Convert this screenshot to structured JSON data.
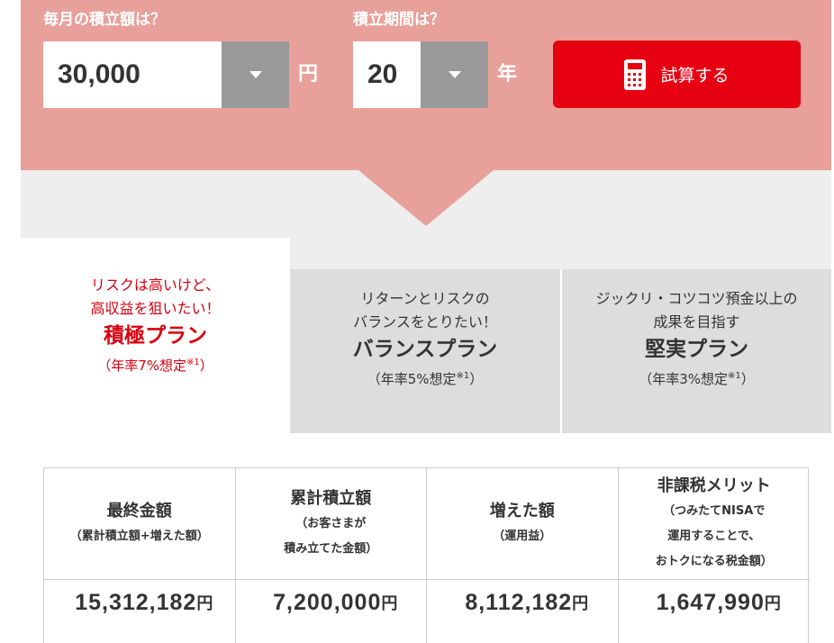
{
  "form": {
    "monthly_label": "毎月の積立額は？",
    "monthly_value": "30,000",
    "monthly_unit": "円",
    "period_label": "積立期間は？",
    "period_value": "20",
    "period_unit": "年",
    "calc_button": "試算する"
  },
  "plans": [
    {
      "desc1": "リスクは高いけど、",
      "desc2": "高収益を狙いたい！",
      "name": "積極プラン",
      "note": "（年率7%想定",
      "mark": "※1",
      "close": "）",
      "selected": true
    },
    {
      "desc1": "リターンとリスクの",
      "desc2": "バランスをとりたい！",
      "name": "バランスプラン",
      "note": "（年率5%想定",
      "mark": "※1",
      "close": "）",
      "selected": false
    },
    {
      "desc1": "ジックリ・コツコツ預金以上の",
      "desc2": "成果を目指す",
      "name": "堅実プラン",
      "note": "（年率3%想定",
      "mark": "※1",
      "close": "）",
      "selected": false
    }
  ],
  "results": [
    {
      "title": "最終金額",
      "sub1": "（累計積立額+増えた額）",
      "sub2": "",
      "sub3": "",
      "value": "15,312,182",
      "unit": "円"
    },
    {
      "title": "累計積立額",
      "sub1": "（お客さまが",
      "sub2": "積み立てた金額）",
      "sub3": "",
      "value": "7,200,000",
      "unit": "円"
    },
    {
      "title": "増えた額",
      "sub1": "（運用益）",
      "sub2": "",
      "sub3": "",
      "value": "8,112,182",
      "unit": "円"
    },
    {
      "title": "非課税メリット",
      "sub1": "（つみたてNISAで",
      "sub2": "運用することで、",
      "sub3": "おトクになる税金額）",
      "value": "1,647,990",
      "unit": "円"
    }
  ],
  "colors": {
    "accent": "#e60012",
    "panel": "#e8a09a",
    "plan_active": "#d7000f",
    "plan_inactive_bg": "#dddddd"
  }
}
